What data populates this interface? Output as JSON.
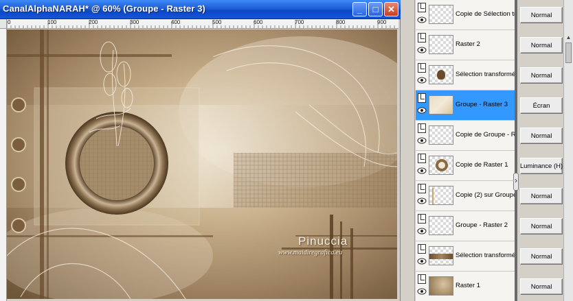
{
  "window": {
    "title": "CanalAlphaNARAH* @  60% (Groupe - Raster 3)",
    "buttons": {
      "minimize": "_",
      "maximize": "□",
      "close": "✕"
    }
  },
  "ruler": {
    "labels": [
      "0",
      "100",
      "200",
      "300",
      "400",
      "500",
      "600",
      "700",
      "800",
      "900"
    ]
  },
  "canvas": {
    "watermark_name": "Pinuccia",
    "watermark_url": "www.maidiregrafica.eu"
  },
  "layers": [
    {
      "name": "Copie de Sélection tr",
      "blend": "Normal",
      "thumb": "empty",
      "selected": false
    },
    {
      "name": "Raster 2",
      "blend": "Normal",
      "thumb": "empty",
      "selected": false
    },
    {
      "name": "Sélection transformé",
      "blend": "Normal",
      "thumb": "flower",
      "selected": false
    },
    {
      "name": "Groupe - Raster 3",
      "blend": "Écran",
      "thumb": "beige",
      "selected": true
    },
    {
      "name": "Copie de Groupe - R",
      "blend": "Normal",
      "thumb": "empty",
      "selected": false
    },
    {
      "name": "Copie de Raster 1",
      "blend": "Luminance (H)",
      "thumb": "ring",
      "selected": false
    },
    {
      "name": "Copie (2) sur Groupe",
      "blend": "Normal",
      "thumb": "line",
      "selected": false
    },
    {
      "name": "Groupe - Raster 2",
      "blend": "Normal",
      "thumb": "empty",
      "selected": false
    },
    {
      "name": "Sélection transformé",
      "blend": "Normal",
      "thumb": "band",
      "selected": false
    },
    {
      "name": "Raster 1",
      "blend": "Normal",
      "thumb": "sepia",
      "selected": false
    }
  ],
  "colors": {
    "titlebar": "#1e5fd6",
    "selection": "#3399ff",
    "sepia": "#a58f70"
  }
}
